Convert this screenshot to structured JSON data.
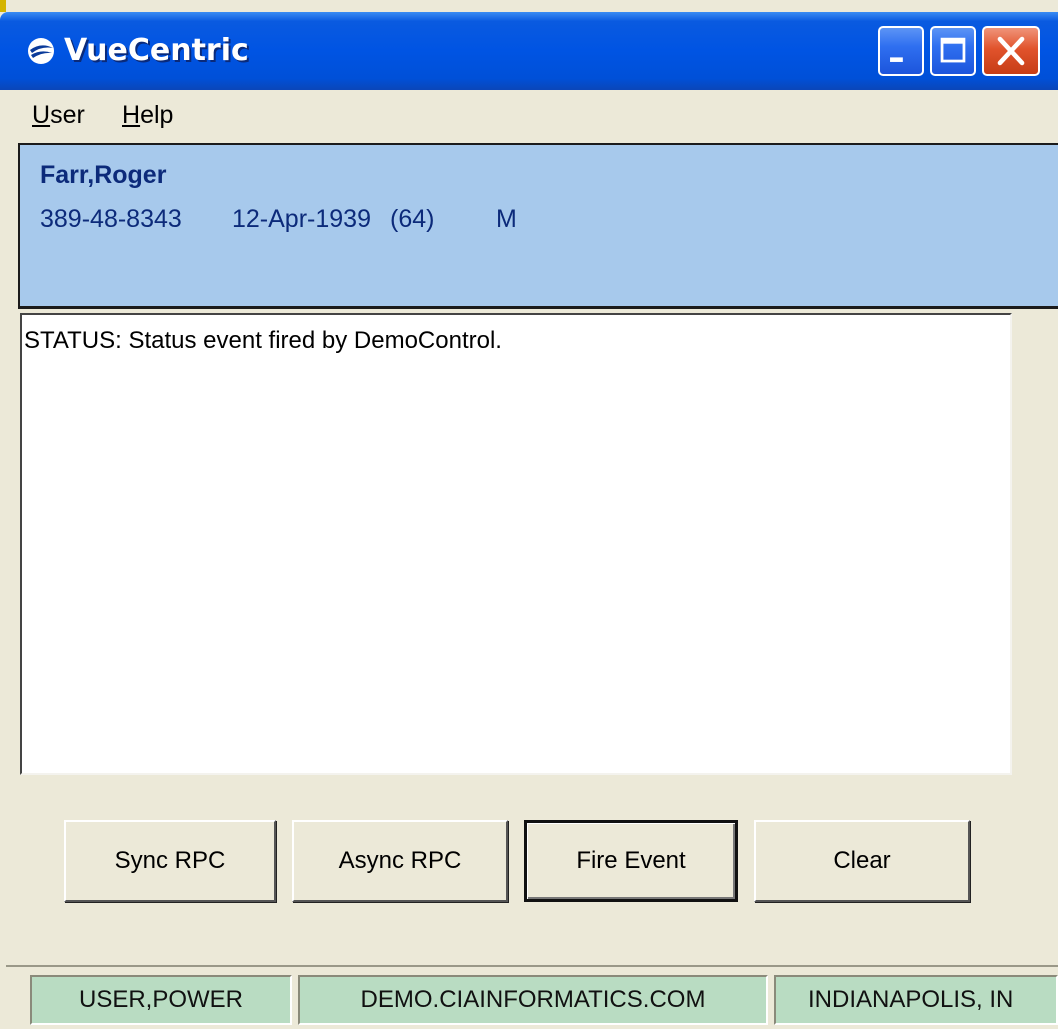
{
  "window": {
    "title": "VueCentric",
    "controls": {
      "minimize": "minimize-icon",
      "maximize": "maximize-icon",
      "close": "close-icon"
    }
  },
  "menu": {
    "user": {
      "accel": "U",
      "rest": "ser"
    },
    "help": {
      "accel": "H",
      "rest": "elp"
    }
  },
  "patient": {
    "name": "Farr,Roger",
    "ssn": "389-48-8343",
    "dob": "12-Apr-1939",
    "age": "(64)",
    "sex": "M"
  },
  "log": {
    "lines": [
      "STATUS: Status event fired by DemoControl."
    ]
  },
  "buttons": {
    "sync_rpc": "Sync RPC",
    "async_rpc": "Async RPC",
    "fire_event": "Fire Event",
    "clear": "Clear"
  },
  "statusbar": {
    "user": "USER,POWER",
    "server": "DEMO.CIAINFORMATICS.COM",
    "location": "INDIANAPOLIS, IN"
  },
  "colors": {
    "titlebar": "#0054e3",
    "patient_banner": "#a7c9ec",
    "patient_text": "#0c2a7a",
    "status_panel": "#b9dcc2",
    "window_bg": "#ece9d8"
  }
}
